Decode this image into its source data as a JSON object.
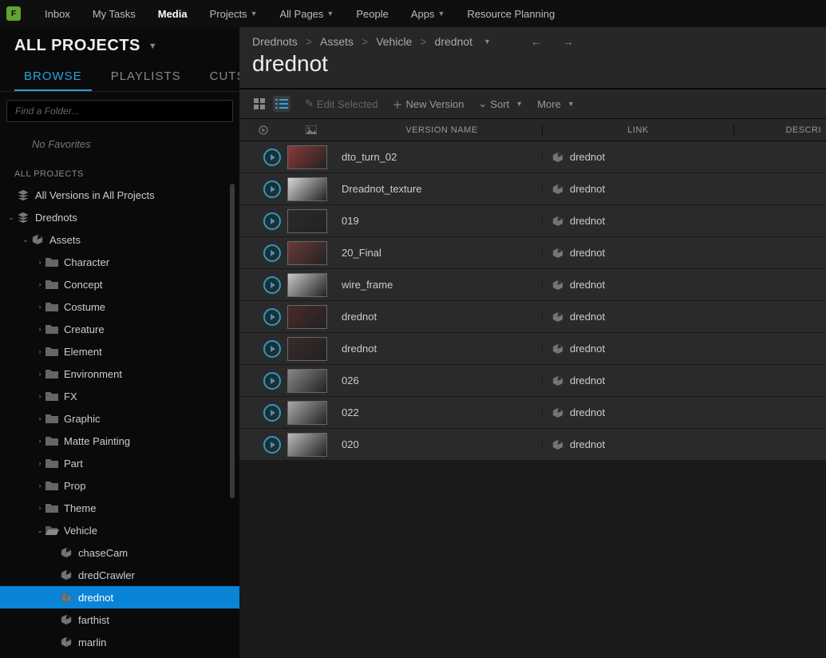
{
  "logo": "F",
  "topnav": [
    {
      "label": "Inbox",
      "dropdown": false
    },
    {
      "label": "My Tasks",
      "dropdown": false
    },
    {
      "label": "Media",
      "dropdown": false,
      "active": true
    },
    {
      "label": "Projects",
      "dropdown": true
    },
    {
      "label": "All Pages",
      "dropdown": true
    },
    {
      "label": "People",
      "dropdown": false
    },
    {
      "label": "Apps",
      "dropdown": true
    },
    {
      "label": "Resource Planning",
      "dropdown": false
    }
  ],
  "sidebar": {
    "title": "ALL PROJECTS",
    "tabs": [
      {
        "label": "BROWSE",
        "active": true
      },
      {
        "label": "PLAYLISTS"
      },
      {
        "label": "CUTS"
      }
    ],
    "search_placeholder": "Find a Folder...",
    "no_favorites": "No Favorites",
    "section_label": "ALL PROJECTS",
    "tree": [
      {
        "label": "All Versions in All Projects",
        "indent": 0,
        "caret": "",
        "icon": "stack"
      },
      {
        "label": "Drednots",
        "indent": 0,
        "caret": "open",
        "icon": "stack"
      },
      {
        "label": "Assets",
        "indent": 1,
        "caret": "open",
        "icon": "cube"
      },
      {
        "label": "Character",
        "indent": 2,
        "caret": "closed",
        "icon": "folder"
      },
      {
        "label": "Concept",
        "indent": 2,
        "caret": "closed",
        "icon": "folder"
      },
      {
        "label": "Costume",
        "indent": 2,
        "caret": "closed",
        "icon": "folder"
      },
      {
        "label": "Creature",
        "indent": 2,
        "caret": "closed",
        "icon": "folder"
      },
      {
        "label": "Element",
        "indent": 2,
        "caret": "closed",
        "icon": "folder"
      },
      {
        "label": "Environment",
        "indent": 2,
        "caret": "closed",
        "icon": "folder"
      },
      {
        "label": "FX",
        "indent": 2,
        "caret": "closed",
        "icon": "folder"
      },
      {
        "label": "Graphic",
        "indent": 2,
        "caret": "closed",
        "icon": "folder"
      },
      {
        "label": "Matte Painting",
        "indent": 2,
        "caret": "closed",
        "icon": "folder"
      },
      {
        "label": "Part",
        "indent": 2,
        "caret": "closed",
        "icon": "folder"
      },
      {
        "label": "Prop",
        "indent": 2,
        "caret": "closed",
        "icon": "folder"
      },
      {
        "label": "Theme",
        "indent": 2,
        "caret": "closed",
        "icon": "folder"
      },
      {
        "label": "Vehicle",
        "indent": 2,
        "caret": "open",
        "icon": "folder-open"
      },
      {
        "label": "chaseCam",
        "indent": 3,
        "caret": "",
        "icon": "cube"
      },
      {
        "label": "dredCrawler",
        "indent": 3,
        "caret": "",
        "icon": "cube"
      },
      {
        "label": "drednot",
        "indent": 3,
        "caret": "",
        "icon": "cube",
        "selected": true
      },
      {
        "label": "farthist",
        "indent": 3,
        "caret": "",
        "icon": "cube"
      },
      {
        "label": "marlin",
        "indent": 3,
        "caret": "",
        "icon": "cube"
      }
    ]
  },
  "breadcrumb": [
    "Drednots",
    "Assets",
    "Vehicle",
    "drednot"
  ],
  "page_title": "drednot",
  "toolbar": {
    "edit": "Edit Selected",
    "new_version": "New Version",
    "sort": "Sort",
    "more": "More"
  },
  "columns": {
    "name": "VERSION NAME",
    "link": "LINK",
    "desc": "DESCRI"
  },
  "rows": [
    {
      "name": "dto_turn_02",
      "link": "drednot",
      "thumb": "#8a3a3a"
    },
    {
      "name": "Dreadnot_texture",
      "link": "drednot",
      "thumb": "#d8d8d8"
    },
    {
      "name": "019",
      "link": "drednot",
      "thumb": "#2a2a2a"
    },
    {
      "name": "20_Final",
      "link": "drednot",
      "thumb": "#6a3a3a"
    },
    {
      "name": "wire_frame",
      "link": "drednot",
      "thumb": "#c8c8c8"
    },
    {
      "name": "drednot",
      "link": "drednot",
      "thumb": "#4a2a2a"
    },
    {
      "name": "drednot",
      "link": "drednot",
      "thumb": "#3a2a2a"
    },
    {
      "name": "026",
      "link": "drednot",
      "thumb": "#888"
    },
    {
      "name": "022",
      "link": "drednot",
      "thumb": "#aaa"
    },
    {
      "name": "020",
      "link": "drednot",
      "thumb": "#bbb"
    }
  ]
}
